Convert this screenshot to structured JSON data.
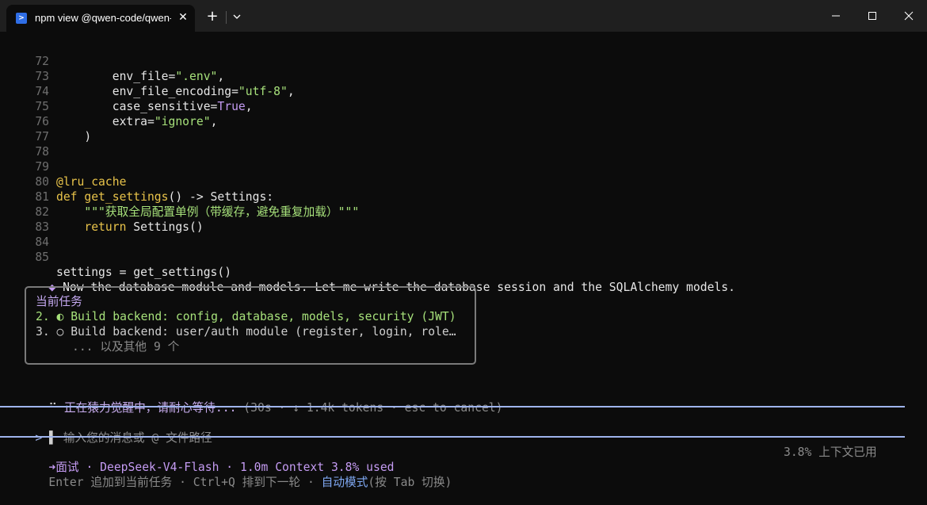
{
  "window": {
    "tab_title": "npm view @qwen-code/qwen-",
    "tab_icon": "powershell-icon",
    "close_tab_glyph": "✕",
    "new_tab_glyph": "+"
  },
  "code": {
    "lines": [
      {
        "n": "72",
        "indent": "        ",
        "pre": "env_file=",
        "str": "\".env\"",
        "post": ","
      },
      {
        "n": "73",
        "indent": "        ",
        "pre": "env_file_encoding=",
        "str": "\"utf-8\"",
        "post": ","
      },
      {
        "n": "74",
        "indent": "        ",
        "pre": "case_sensitive=",
        "bool": "True",
        "post": ","
      },
      {
        "n": "75",
        "indent": "        ",
        "pre": "extra=",
        "str": "\"ignore\"",
        "post": ","
      },
      {
        "n": "76",
        "indent": "    ",
        "pre": ")"
      },
      {
        "n": "77"
      },
      {
        "n": "78"
      },
      {
        "n": "79",
        "kw": "@lru_cache"
      },
      {
        "n": "80",
        "kw": "def",
        "pre": " ",
        "fn": "get_settings",
        "post": "() -> Settings:"
      },
      {
        "n": "81",
        "indent": "    ",
        "str": "\"\"\"获取全局配置单例（带缓存，避免重复加载）\"\"\""
      },
      {
        "n": "82",
        "indent": "    ",
        "kw": "return",
        "post": " Settings()"
      },
      {
        "n": "83"
      },
      {
        "n": "84"
      },
      {
        "n": "85",
        "pre": "settings = get_settings()"
      }
    ]
  },
  "assistant_message": {
    "bullet": "◆",
    "text": "Now the database module and models. Let me write the database session and the SQLAlchemy models."
  },
  "task_box": {
    "title": "当前任务",
    "items": [
      {
        "num": "2.",
        "marker": "◐",
        "text": "Build backend: config, database, models, security (JWT)"
      },
      {
        "num": "3.",
        "marker": "○",
        "text": "Build backend: user/auth module (register, login, role…"
      }
    ],
    "more": "... 以及其他 9 个"
  },
  "progress": {
    "spinner": "⠋",
    "text": "正在猿力觉醒中，请耐心等待...",
    "detail": "(30s · ↓ 1.4k tokens · esc to cancel)"
  },
  "input": {
    "prompt": ">",
    "cursor": "▌",
    "placeholder": "输入您的消息或 @ 文件路径"
  },
  "footer": {
    "mode_arrow": "➜",
    "mode": "面试",
    "model": " · DeepSeek-V4-Flash · 1.0m Context 3.8% used",
    "context_right": "3.8% 上下文已用",
    "hint_enter": "Enter 追加到当前任务 · Ctrl+Q 排到下一轮 · ",
    "hint_auto": "自动模式",
    "hint_tab": "(按 Tab 切换)"
  },
  "colors": {
    "background": "#0c0c0c",
    "string": "#a6e07a",
    "keyword": "#e8c34a",
    "accent_purple": "#c49bf2",
    "rule_blue": "#9fb4ec"
  }
}
